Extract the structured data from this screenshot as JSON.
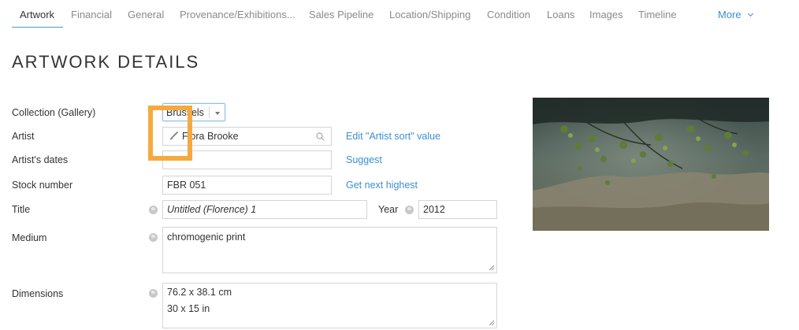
{
  "tabs": [
    {
      "label": "Artwork",
      "active": true
    },
    {
      "label": "Financial"
    },
    {
      "label": "General"
    },
    {
      "label": "Provenance/Exhibitions..."
    },
    {
      "label": "Sales Pipeline"
    },
    {
      "label": "Location/Shipping"
    },
    {
      "label": "Condition"
    },
    {
      "label": "Loans"
    },
    {
      "label": "Images"
    },
    {
      "label": "Timeline"
    }
  ],
  "more_label": "More",
  "page_title": "ARTWORK DETAILS",
  "fields": {
    "collection": {
      "label": "Collection (Gallery)",
      "value": "Brussels"
    },
    "artist": {
      "label": "Artist",
      "value": "Flora Brooke",
      "link": "Edit \"Artist sort\" value"
    },
    "artist_dates": {
      "label": "Artist's dates",
      "value": "",
      "link": "Suggest"
    },
    "stock_number": {
      "label": "Stock number",
      "value": "FBR 051",
      "link": "Get next highest"
    },
    "title": {
      "label": "Title",
      "value": "Untitled (Florence) 1"
    },
    "year": {
      "label": "Year",
      "value": "2012"
    },
    "medium": {
      "label": "Medium",
      "value": "chromogenic print"
    },
    "dimensions": {
      "label": "Dimensions",
      "line1": "76.2 x 38.1 cm",
      "line2": "30 x 15 in"
    }
  },
  "icons": {
    "artist_icon": "paintbrush-icon",
    "search_icon": "search-icon",
    "globe_icon": "globe-icon"
  },
  "colors": {
    "accent": "#3c8fcf",
    "highlight": "#f6a940"
  }
}
